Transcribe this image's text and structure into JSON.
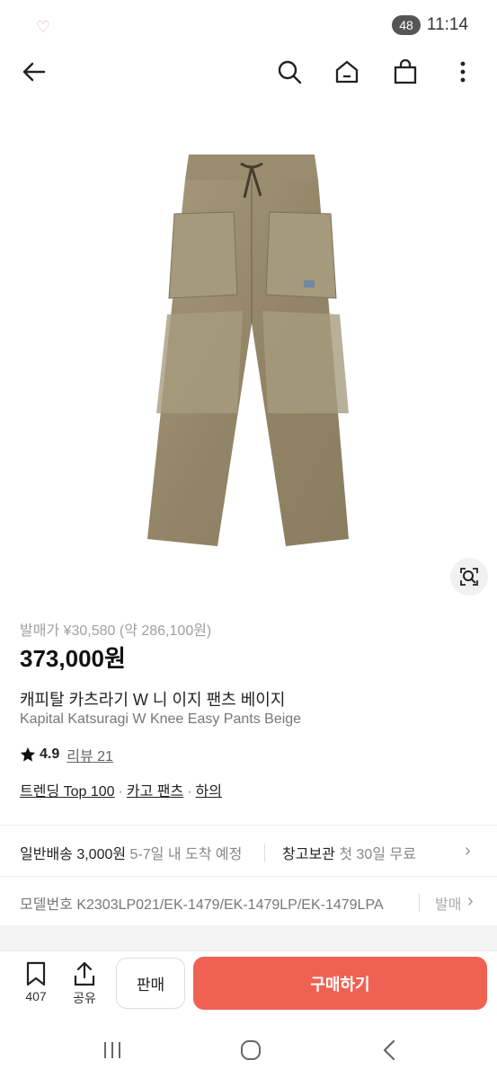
{
  "status": {
    "time": "11:14",
    "notification_count": "48"
  },
  "colors": {
    "buy": "#ef6253",
    "accent_text": "#111111"
  },
  "header_icons": [
    "back-arrow-icon",
    "search-icon",
    "home-icon",
    "shopping-bag-icon",
    "more-vert-icon"
  ],
  "product": {
    "release_price": "발매가 ¥30,580 (약 286,100원)",
    "price": "373,000원",
    "name_ko": "캐피탈 카츠라기 W 니 이지 팬츠 베이지",
    "name_en": "Kapital Katsuragi W Knee Easy Pants Beige",
    "rating": "4.9",
    "review_label": "리뷰 21",
    "tags": [
      "트렌딩 Top 100",
      "카고 팬츠",
      "하의"
    ]
  },
  "shipping": {
    "label": "일반배송 3,000원",
    "eta": "5-7일 내 도착 예정",
    "storage_label": "창고보관",
    "storage_desc": "첫 30일 무료"
  },
  "model": {
    "label": "모델번호 K2303LP021/EK-1479/EK-1479LP/EK-1479LPA",
    "extra": "발매"
  },
  "bottom": {
    "bookmark_count": "407",
    "share_label": "공유",
    "sell_label": "판매",
    "buy_label": "구매하기"
  }
}
